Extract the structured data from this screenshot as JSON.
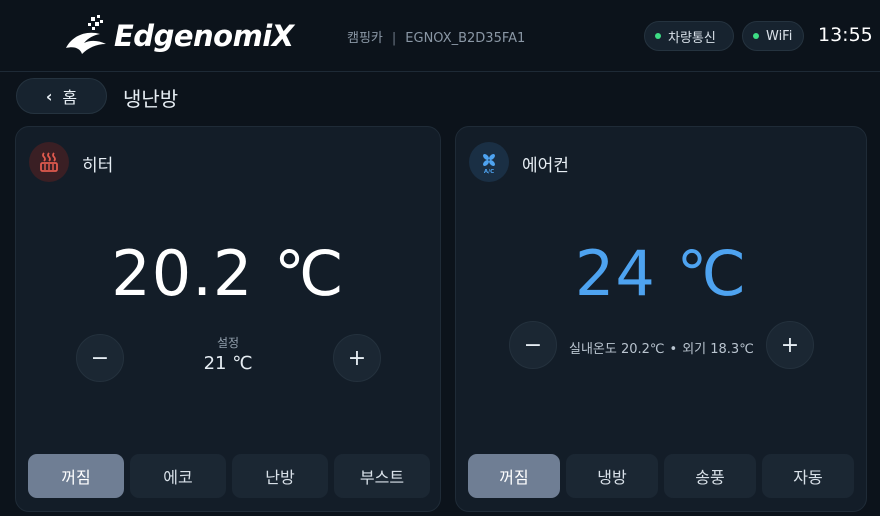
{
  "topbar": {
    "brand": "EdgenomiX",
    "device_type": "캠핑카",
    "device_separator": "|",
    "device_id": "EGNOX_B2D35FA1",
    "vehicle_comm_label": "차량통신",
    "wifi_label": "WiFi",
    "time": "13:55",
    "status_color": "#3ddc84"
  },
  "nav": {
    "back_icon": "‹",
    "back_label": "홈",
    "page_title": "냉난방"
  },
  "heater": {
    "title": "히터",
    "icon": "heater-icon",
    "current_temp": "20.2 ℃",
    "setpoint_label": "설정",
    "setpoint_value": "21 ℃",
    "minus": "−",
    "plus": "+",
    "modes": [
      "꺼짐",
      "에코",
      "난방",
      "부스트"
    ],
    "active_mode": "꺼짐",
    "accent": "#e05a4e"
  },
  "aircon": {
    "title": "에어컨",
    "icon": "aircon-icon",
    "current_temp": "24 ℃",
    "indoor_label": "실내온도 20.2℃",
    "bullet": "•",
    "outdoor_label": "외기 18.3℃",
    "minus": "−",
    "plus": "+",
    "modes": [
      "꺼짐",
      "냉방",
      "송풍",
      "자동"
    ],
    "active_mode": "꺼짐",
    "accent": "#4ea3f0"
  }
}
